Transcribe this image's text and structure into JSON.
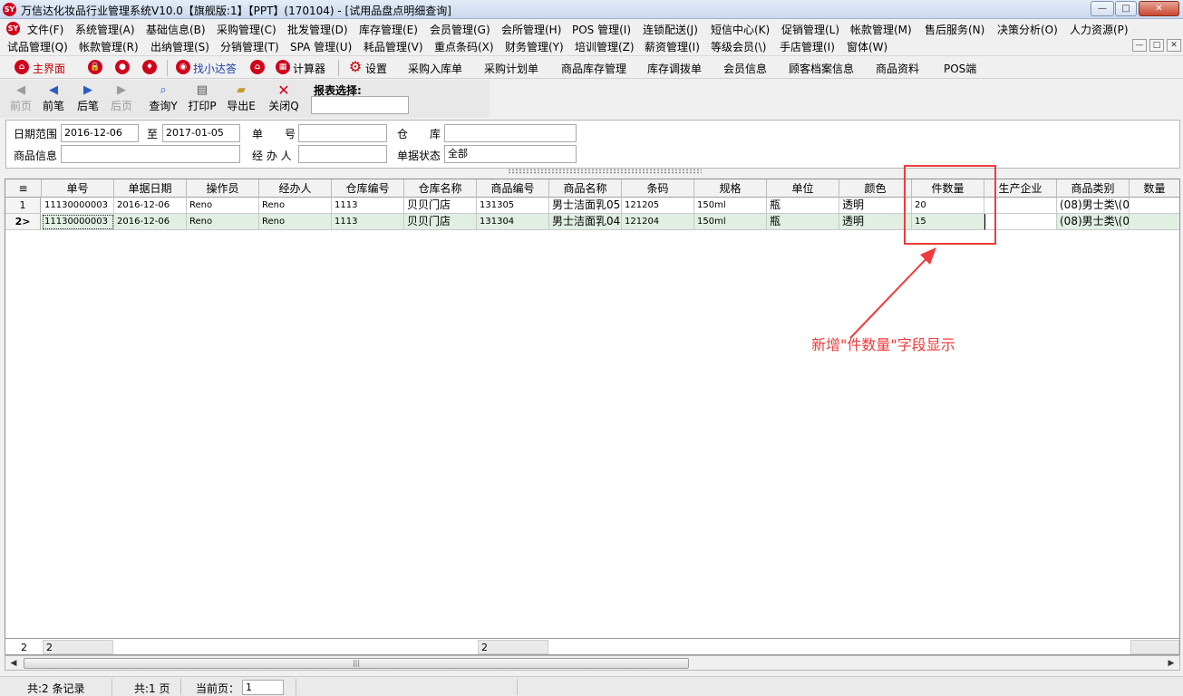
{
  "window": {
    "title": "万信达化妆品行业管理系统V10.0【旗舰版:1】【PPT】(170104) - [试用品盘点明细查询]",
    "logo_text": "SY",
    "minimize": "—",
    "maximize": "□",
    "close": "✕"
  },
  "menu_row1": [
    {
      "label": "文件(F)"
    },
    {
      "label": "系统管理(A)"
    },
    {
      "label": "基础信息(B)"
    },
    {
      "label": "采购管理(C)"
    },
    {
      "label": "批发管理(D)"
    },
    {
      "label": "库存管理(E)"
    },
    {
      "label": "会员管理(G)"
    },
    {
      "label": "会所管理(H)"
    },
    {
      "label": "POS 管理(I)"
    },
    {
      "label": "连锁配送(J)"
    },
    {
      "label": "短信中心(K)"
    },
    {
      "label": "促销管理(L)"
    },
    {
      "label": "帐款管理(M)"
    },
    {
      "label": "售后服务(N)"
    },
    {
      "label": "决策分析(O)"
    },
    {
      "label": "人力资源(P)"
    }
  ],
  "menu_row2": [
    {
      "label": "试品管理(Q)"
    },
    {
      "label": "帐款管理(R)"
    },
    {
      "label": "出纳管理(S)"
    },
    {
      "label": "分销管理(T)"
    },
    {
      "label": "SPA 管理(U)"
    },
    {
      "label": "耗品管理(V)"
    },
    {
      "label": "重点条码(X)"
    },
    {
      "label": "财务管理(Y)"
    },
    {
      "label": "培训管理(Z)"
    },
    {
      "label": "薪资管理(I)"
    },
    {
      "label": "等级会员(\\)"
    },
    {
      "label": "手店管理(I)"
    },
    {
      "label": "窗体(W)"
    }
  ],
  "toolbar": {
    "main": "主界面",
    "find": "找小达答",
    "calculator": "计算器",
    "settings": "设置",
    "links": [
      {
        "label": "采购入库单"
      },
      {
        "label": "采购计划单"
      },
      {
        "label": "商品库存管理"
      },
      {
        "label": "库存调拨单"
      },
      {
        "label": "会员信息"
      },
      {
        "label": "顾客档案信息"
      },
      {
        "label": "商品资料"
      },
      {
        "label": "POS端"
      }
    ]
  },
  "nav": {
    "first": "前页",
    "prev": "前笔",
    "next": "后笔",
    "last": "后页",
    "query": "查询Y",
    "print": "打印P",
    "export": "导出E",
    "close": "关闭Q",
    "report_label": "报表选择:",
    "report_value": ""
  },
  "filter": {
    "date_label": "日期范围",
    "date_from": "2016-12-06",
    "to_label": "至",
    "date_to": "2017-01-05",
    "bill_label": "单　　号",
    "bill_value": "",
    "wh_label": "仓　　库",
    "wh_value": "",
    "goods_label": "商品信息",
    "goods_value": "",
    "handler_label": "经 办 人",
    "handler_value": "",
    "status_label": "单据状态",
    "status_value": "全部"
  },
  "grid": {
    "columns": [
      "单号",
      "单据日期",
      "操作员",
      "经办人",
      "仓库编号",
      "仓库名称",
      "商品编号",
      "商品名称",
      "条码",
      "规格",
      "单位",
      "颜色",
      "件数量",
      "生产企业",
      "商品类别",
      "数量"
    ],
    "rows": [
      {
        "marker": "1",
        "cells": [
          "11130000003",
          "2016-12-06",
          "Reno",
          "Reno",
          "1113",
          "贝贝门店",
          "131305",
          "男士洁面乳05",
          "121205",
          "150ml",
          "瓶",
          "透明",
          "20",
          "",
          "(08)男士类\\(0",
          ""
        ]
      },
      {
        "marker": "2>",
        "cells": [
          "11130000003",
          "2016-12-06",
          "Reno",
          "Reno",
          "1113",
          "贝贝门店",
          "131304",
          "男士洁面乳04",
          "121204",
          "150ml",
          "瓶",
          "透明",
          "15",
          "",
          "(08)男士类\\(0",
          ""
        ]
      }
    ]
  },
  "annotation": {
    "text": "新增\"件数量\"字段显示",
    "color": "#ef3b3b"
  },
  "summary": {
    "count": "2",
    "first_col": "2",
    "goods_col": "2"
  },
  "status": {
    "records": "共:2 条记录",
    "pages": "共:1 页",
    "current_label": "当前页：",
    "current_value": "1"
  }
}
